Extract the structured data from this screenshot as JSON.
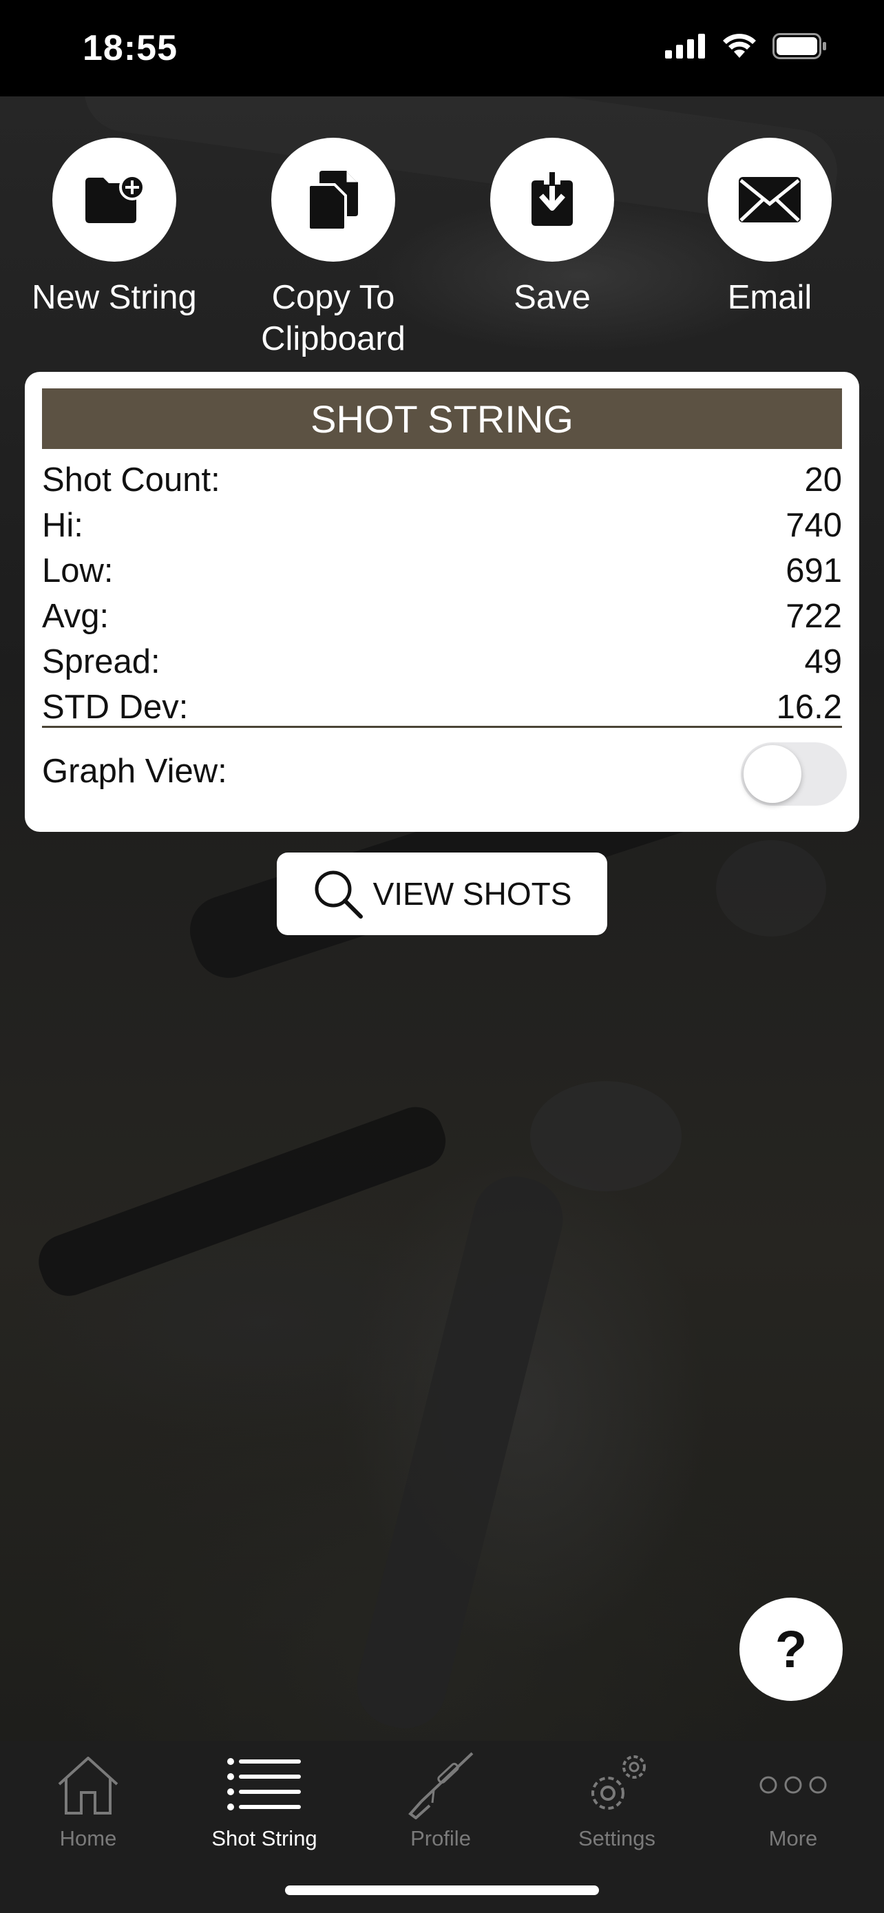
{
  "status_bar": {
    "time": "18:55",
    "icons": [
      "signal-icon",
      "wifi-icon",
      "battery-icon"
    ]
  },
  "actions": [
    {
      "label": "New String",
      "icon": "folder-plus-icon"
    },
    {
      "label": "Copy To\nClipboard",
      "icon": "copy-icon"
    },
    {
      "label": "Save",
      "icon": "download-icon"
    },
    {
      "label": "Email",
      "icon": "envelope-icon"
    }
  ],
  "card": {
    "title": "SHOT STRING",
    "stats": [
      {
        "label": "Shot Count:",
        "value": "20"
      },
      {
        "label": "Hi:",
        "value": "740"
      },
      {
        "label": "Low:",
        "value": "691"
      },
      {
        "label": "Avg:",
        "value": "722"
      },
      {
        "label": "Spread:",
        "value": "49"
      },
      {
        "label": "STD Dev:",
        "value": "16.2"
      }
    ],
    "graph_view_label": "Graph View:",
    "graph_view_on": false
  },
  "view_shots_label": "VIEW SHOTS",
  "help_label": "?",
  "tabs": [
    {
      "label": "Home",
      "icon": "home-icon",
      "active": false
    },
    {
      "label": "Shot String",
      "icon": "list-icon",
      "active": true
    },
    {
      "label": "Profile",
      "icon": "rifle-icon",
      "active": false
    },
    {
      "label": "Settings",
      "icon": "gears-icon",
      "active": false
    },
    {
      "label": "More",
      "icon": "more-icon",
      "active": false
    }
  ],
  "colors": {
    "header_bg": "#5c5243",
    "tab_active": "#ffffff",
    "tab_inactive": "#7a7a7a"
  }
}
